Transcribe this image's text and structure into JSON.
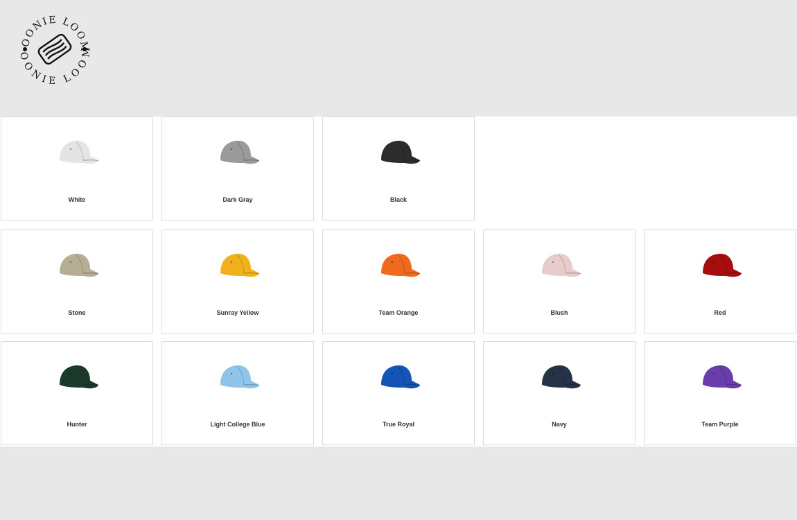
{
  "brand": {
    "logo_text": "JOONIE LOOM"
  },
  "swatches": [
    {
      "label": "White",
      "color": "#e4e4e4"
    },
    {
      "label": "Dark Gray",
      "color": "#9a9a9a"
    },
    {
      "label": "Black",
      "color": "#2c2c2c"
    },
    {
      "label": "Stone",
      "color": "#b7ad94"
    },
    {
      "label": "Sunray Yellow",
      "color": "#f0b11a"
    },
    {
      "label": "Team Orange",
      "color": "#ef6a1e"
    },
    {
      "label": "Blush",
      "color": "#e6cccc"
    },
    {
      "label": "Red",
      "color": "#a60e0e"
    },
    {
      "label": "Hunter",
      "color": "#1c3a2c"
    },
    {
      "label": "Light College Blue",
      "color": "#8ec5e8"
    },
    {
      "label": "True Royal",
      "color": "#1454b4"
    },
    {
      "label": "Navy",
      "color": "#243346"
    },
    {
      "label": "Team Purple",
      "color": "#6a3eaa"
    }
  ]
}
